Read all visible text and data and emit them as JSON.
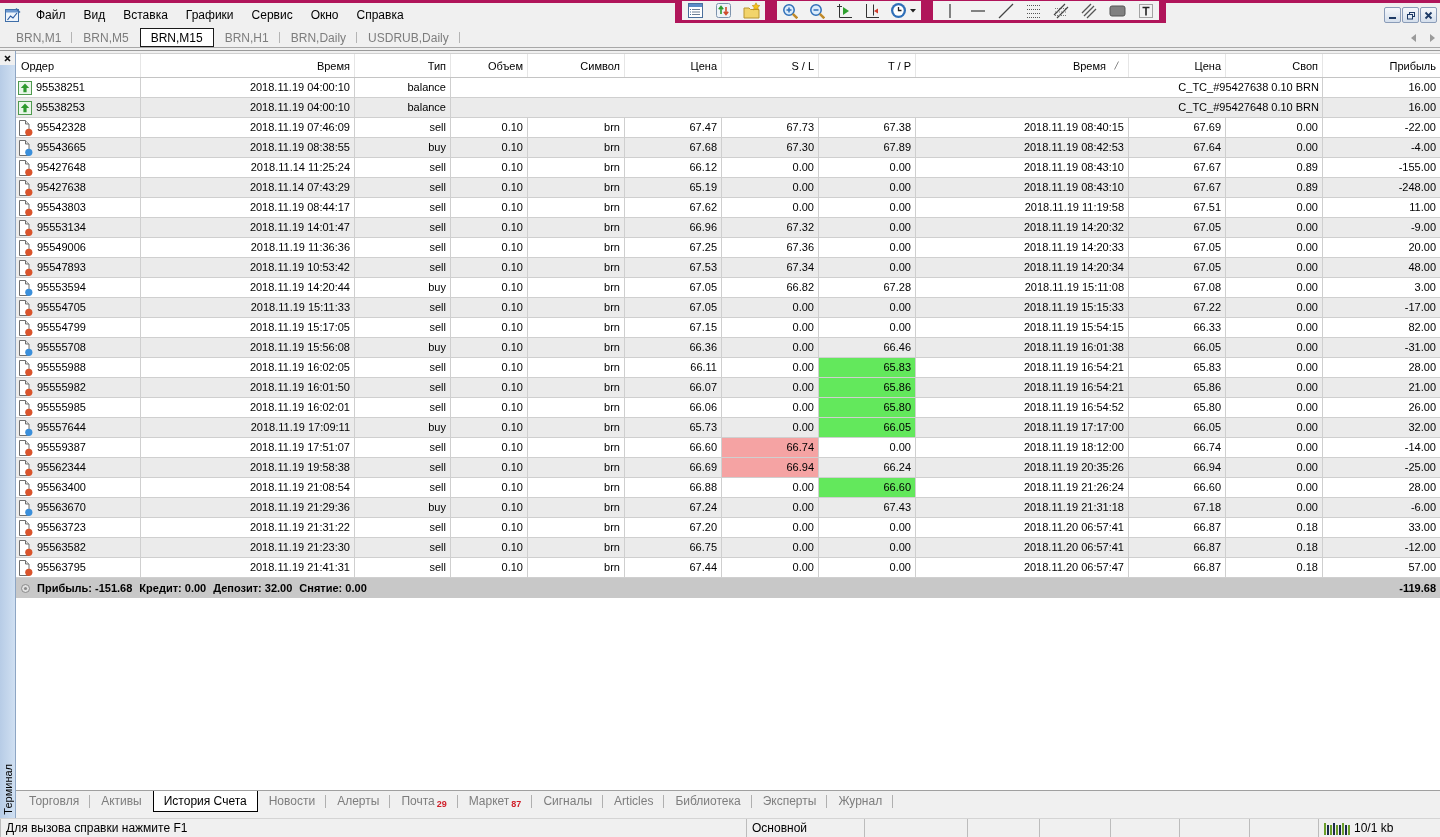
{
  "menu": {
    "items": [
      "Файл",
      "Вид",
      "Вставка",
      "Графики",
      "Сервис",
      "Окно",
      "Справка"
    ]
  },
  "chart_tabs": [
    {
      "label": "BRN,M1",
      "selected": false
    },
    {
      "label": "BRN,M5",
      "selected": false
    },
    {
      "label": "BRN,M15",
      "selected": true
    },
    {
      "label": "BRN,H1",
      "selected": false
    },
    {
      "label": "BRN,Daily",
      "selected": false
    },
    {
      "label": "USDRUB,Daily",
      "selected": false
    }
  ],
  "terminal": {
    "title": "Терминал",
    "table": {
      "columns": [
        {
          "label": "Ордер",
          "sorted": false
        },
        {
          "label": "Время",
          "sorted": false
        },
        {
          "label": "Тип",
          "sorted": false
        },
        {
          "label": "Объем",
          "sorted": false
        },
        {
          "label": "Символ",
          "sorted": false
        },
        {
          "label": "Цена",
          "sorted": false
        },
        {
          "label": "S / L",
          "sorted": false
        },
        {
          "label": "T / P",
          "sorted": false
        },
        {
          "label": "Время",
          "sorted": true
        },
        {
          "label": "Цена",
          "sorted": false
        },
        {
          "label": "Своп",
          "sorted": false
        },
        {
          "label": "Прибыль",
          "sorted": false
        }
      ],
      "rows": [
        {
          "kind": "balance",
          "order": "95538251",
          "open_time": "2018.11.19 04:00:10",
          "type": "balance",
          "comment": "C_TC_#95427638 0.10 BRN",
          "profit": "16.00"
        },
        {
          "kind": "balance",
          "order": "95538253",
          "open_time": "2018.11.19 04:00:10",
          "type": "balance",
          "comment": "C_TC_#95427648 0.10 BRN",
          "profit": "16.00"
        },
        {
          "kind": "trade",
          "color": "#d9532b",
          "order": "95542328",
          "open_time": "2018.11.19 07:46:09",
          "type": "sell",
          "volume": "0.10",
          "symbol": "brn",
          "open_price": "67.47",
          "sl": "67.73",
          "tp": "67.38",
          "close_time": "2018.11.19 08:40:15",
          "close_price": "67.69",
          "swap": "0.00",
          "profit": "-22.00",
          "sl_hit": false,
          "tp_hit": false
        },
        {
          "kind": "trade",
          "color": "#3a8fdb",
          "order": "95543665",
          "open_time": "2018.11.19 08:38:55",
          "type": "buy",
          "volume": "0.10",
          "symbol": "brn",
          "open_price": "67.68",
          "sl": "67.30",
          "tp": "67.89",
          "close_time": "2018.11.19 08:42:53",
          "close_price": "67.64",
          "swap": "0.00",
          "profit": "-4.00",
          "sl_hit": false,
          "tp_hit": false
        },
        {
          "kind": "trade",
          "color": "#d9532b",
          "order": "95427648",
          "open_time": "2018.11.14 11:25:24",
          "type": "sell",
          "volume": "0.10",
          "symbol": "brn",
          "open_price": "66.12",
          "sl": "0.00",
          "tp": "0.00",
          "close_time": "2018.11.19 08:43:10",
          "close_price": "67.67",
          "swap": "0.89",
          "profit": "-155.00",
          "sl_hit": false,
          "tp_hit": false
        },
        {
          "kind": "trade",
          "color": "#d9532b",
          "order": "95427638",
          "open_time": "2018.11.14 07:43:29",
          "type": "sell",
          "volume": "0.10",
          "symbol": "brn",
          "open_price": "65.19",
          "sl": "0.00",
          "tp": "0.00",
          "close_time": "2018.11.19 08:43:10",
          "close_price": "67.67",
          "swap": "0.89",
          "profit": "-248.00",
          "sl_hit": false,
          "tp_hit": false
        },
        {
          "kind": "trade",
          "color": "#d9532b",
          "order": "95543803",
          "open_time": "2018.11.19 08:44:17",
          "type": "sell",
          "volume": "0.10",
          "symbol": "brn",
          "open_price": "67.62",
          "sl": "0.00",
          "tp": "0.00",
          "close_time": "2018.11.19 11:19:58",
          "close_price": "67.51",
          "swap": "0.00",
          "profit": "11.00",
          "sl_hit": false,
          "tp_hit": false
        },
        {
          "kind": "trade",
          "color": "#d9532b",
          "order": "95553134",
          "open_time": "2018.11.19 14:01:47",
          "type": "sell",
          "volume": "0.10",
          "symbol": "brn",
          "open_price": "66.96",
          "sl": "67.32",
          "tp": "0.00",
          "close_time": "2018.11.19 14:20:32",
          "close_price": "67.05",
          "swap": "0.00",
          "profit": "-9.00",
          "sl_hit": false,
          "tp_hit": false
        },
        {
          "kind": "trade",
          "color": "#d9532b",
          "order": "95549006",
          "open_time": "2018.11.19 11:36:36",
          "type": "sell",
          "volume": "0.10",
          "symbol": "brn",
          "open_price": "67.25",
          "sl": "67.36",
          "tp": "0.00",
          "close_time": "2018.11.19 14:20:33",
          "close_price": "67.05",
          "swap": "0.00",
          "profit": "20.00",
          "sl_hit": false,
          "tp_hit": false
        },
        {
          "kind": "trade",
          "color": "#d9532b",
          "order": "95547893",
          "open_time": "2018.11.19 10:53:42",
          "type": "sell",
          "volume": "0.10",
          "symbol": "brn",
          "open_price": "67.53",
          "sl": "67.34",
          "tp": "0.00",
          "close_time": "2018.11.19 14:20:34",
          "close_price": "67.05",
          "swap": "0.00",
          "profit": "48.00",
          "sl_hit": false,
          "tp_hit": false
        },
        {
          "kind": "trade",
          "color": "#3a8fdb",
          "order": "95553594",
          "open_time": "2018.11.19 14:20:44",
          "type": "buy",
          "volume": "0.10",
          "symbol": "brn",
          "open_price": "67.05",
          "sl": "66.82",
          "tp": "67.28",
          "close_time": "2018.11.19 15:11:08",
          "close_price": "67.08",
          "swap": "0.00",
          "profit": "3.00",
          "sl_hit": false,
          "tp_hit": false
        },
        {
          "kind": "trade",
          "color": "#d9532b",
          "order": "95554705",
          "open_time": "2018.11.19 15:11:33",
          "type": "sell",
          "volume": "0.10",
          "symbol": "brn",
          "open_price": "67.05",
          "sl": "0.00",
          "tp": "0.00",
          "close_time": "2018.11.19 15:15:33",
          "close_price": "67.22",
          "swap": "0.00",
          "profit": "-17.00",
          "sl_hit": false,
          "tp_hit": false
        },
        {
          "kind": "trade",
          "color": "#d9532b",
          "order": "95554799",
          "open_time": "2018.11.19 15:17:05",
          "type": "sell",
          "volume": "0.10",
          "symbol": "brn",
          "open_price": "67.15",
          "sl": "0.00",
          "tp": "0.00",
          "close_time": "2018.11.19 15:54:15",
          "close_price": "66.33",
          "swap": "0.00",
          "profit": "82.00",
          "sl_hit": false,
          "tp_hit": false
        },
        {
          "kind": "trade",
          "color": "#3a8fdb",
          "order": "95555708",
          "open_time": "2018.11.19 15:56:08",
          "type": "buy",
          "volume": "0.10",
          "symbol": "brn",
          "open_price": "66.36",
          "sl": "0.00",
          "tp": "66.46",
          "close_time": "2018.11.19 16:01:38",
          "close_price": "66.05",
          "swap": "0.00",
          "profit": "-31.00",
          "sl_hit": false,
          "tp_hit": false
        },
        {
          "kind": "trade",
          "color": "#d9532b",
          "order": "95555988",
          "open_time": "2018.11.19 16:02:05",
          "type": "sell",
          "volume": "0.10",
          "symbol": "brn",
          "open_price": "66.11",
          "sl": "0.00",
          "tp": "65.83",
          "close_time": "2018.11.19 16:54:21",
          "close_price": "65.83",
          "swap": "0.00",
          "profit": "28.00",
          "sl_hit": false,
          "tp_hit": true
        },
        {
          "kind": "trade",
          "color": "#d9532b",
          "order": "95555982",
          "open_time": "2018.11.19 16:01:50",
          "type": "sell",
          "volume": "0.10",
          "symbol": "brn",
          "open_price": "66.07",
          "sl": "0.00",
          "tp": "65.86",
          "close_time": "2018.11.19 16:54:21",
          "close_price": "65.86",
          "swap": "0.00",
          "profit": "21.00",
          "sl_hit": false,
          "tp_hit": true
        },
        {
          "kind": "trade",
          "color": "#d9532b",
          "order": "95555985",
          "open_time": "2018.11.19 16:02:01",
          "type": "sell",
          "volume": "0.10",
          "symbol": "brn",
          "open_price": "66.06",
          "sl": "0.00",
          "tp": "65.80",
          "close_time": "2018.11.19 16:54:52",
          "close_price": "65.80",
          "swap": "0.00",
          "profit": "26.00",
          "sl_hit": false,
          "tp_hit": true
        },
        {
          "kind": "trade",
          "color": "#3a8fdb",
          "order": "95557644",
          "open_time": "2018.11.19 17:09:11",
          "type": "buy",
          "volume": "0.10",
          "symbol": "brn",
          "open_price": "65.73",
          "sl": "0.00",
          "tp": "66.05",
          "close_time": "2018.11.19 17:17:00",
          "close_price": "66.05",
          "swap": "0.00",
          "profit": "32.00",
          "sl_hit": false,
          "tp_hit": true
        },
        {
          "kind": "trade",
          "color": "#d9532b",
          "order": "95559387",
          "open_time": "2018.11.19 17:51:07",
          "type": "sell",
          "volume": "0.10",
          "symbol": "brn",
          "open_price": "66.60",
          "sl": "66.74",
          "tp": "0.00",
          "close_time": "2018.11.19 18:12:00",
          "close_price": "66.74",
          "swap": "0.00",
          "profit": "-14.00",
          "sl_hit": true,
          "tp_hit": false
        },
        {
          "kind": "trade",
          "color": "#d9532b",
          "order": "95562344",
          "open_time": "2018.11.19 19:58:38",
          "type": "sell",
          "volume": "0.10",
          "symbol": "brn",
          "open_price": "66.69",
          "sl": "66.94",
          "tp": "66.24",
          "close_time": "2018.11.19 20:35:26",
          "close_price": "66.94",
          "swap": "0.00",
          "profit": "-25.00",
          "sl_hit": true,
          "tp_hit": false
        },
        {
          "kind": "trade",
          "color": "#d9532b",
          "order": "95563400",
          "open_time": "2018.11.19 21:08:54",
          "type": "sell",
          "volume": "0.10",
          "symbol": "brn",
          "open_price": "66.88",
          "sl": "0.00",
          "tp": "66.60",
          "close_time": "2018.11.19 21:26:24",
          "close_price": "66.60",
          "swap": "0.00",
          "profit": "28.00",
          "sl_hit": false,
          "tp_hit": true
        },
        {
          "kind": "trade",
          "color": "#3a8fdb",
          "order": "95563670",
          "open_time": "2018.11.19 21:29:36",
          "type": "buy",
          "volume": "0.10",
          "symbol": "brn",
          "open_price": "67.24",
          "sl": "0.00",
          "tp": "67.43",
          "close_time": "2018.11.19 21:31:18",
          "close_price": "67.18",
          "swap": "0.00",
          "profit": "-6.00",
          "sl_hit": false,
          "tp_hit": false
        },
        {
          "kind": "trade",
          "color": "#d9532b",
          "order": "95563723",
          "open_time": "2018.11.19 21:31:22",
          "type": "sell",
          "volume": "0.10",
          "symbol": "brn",
          "open_price": "67.20",
          "sl": "0.00",
          "tp": "0.00",
          "close_time": "2018.11.20 06:57:41",
          "close_price": "66.87",
          "swap": "0.18",
          "profit": "33.00",
          "sl_hit": false,
          "tp_hit": false
        },
        {
          "kind": "trade",
          "color": "#d9532b",
          "order": "95563582",
          "open_time": "2018.11.19 21:23:30",
          "type": "sell",
          "volume": "0.10",
          "symbol": "brn",
          "open_price": "66.75",
          "sl": "0.00",
          "tp": "0.00",
          "close_time": "2018.11.20 06:57:41",
          "close_price": "66.87",
          "swap": "0.18",
          "profit": "-12.00",
          "sl_hit": false,
          "tp_hit": false
        },
        {
          "kind": "trade",
          "color": "#d9532b",
          "order": "95563795",
          "open_time": "2018.11.19 21:41:31",
          "type": "sell",
          "volume": "0.10",
          "symbol": "brn",
          "open_price": "67.44",
          "sl": "0.00",
          "tp": "0.00",
          "close_time": "2018.11.20 06:57:47",
          "close_price": "66.87",
          "swap": "0.18",
          "profit": "57.00",
          "sl_hit": false,
          "tp_hit": false
        }
      ],
      "summary": {
        "items": [
          "Прибыль: -151.68",
          "Кредит: 0.00",
          "Депозит: 32.00",
          "Снятие: 0.00"
        ],
        "total": "-119.68"
      }
    },
    "tabs": [
      {
        "label": "Торговля",
        "selected": false
      },
      {
        "label": "Активы",
        "selected": false
      },
      {
        "label": "История Счета",
        "selected": true
      },
      {
        "label": "Новости",
        "selected": false
      },
      {
        "label": "Алерты",
        "selected": false
      },
      {
        "label": "Почта",
        "count": "29",
        "selected": false
      },
      {
        "label": "Маркет",
        "count": "87",
        "selected": false
      },
      {
        "label": "Сигналы",
        "selected": false
      },
      {
        "label": "Articles",
        "selected": false
      },
      {
        "label": "Библиотека",
        "selected": false
      },
      {
        "label": "Эксперты",
        "selected": false
      },
      {
        "label": "Журнал",
        "selected": false
      }
    ]
  },
  "status_bar": {
    "help": "Для вызова справки нажмите F1",
    "profile": "Основной",
    "traffic": "10/1 kb"
  }
}
